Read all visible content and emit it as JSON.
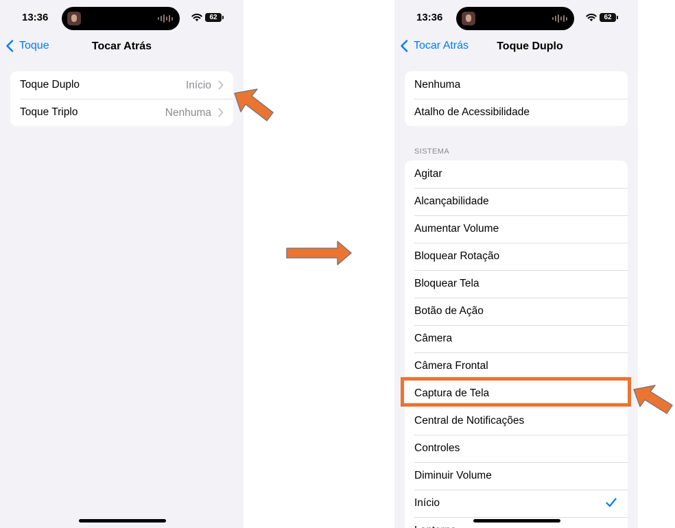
{
  "colors": {
    "accent": "#007aff",
    "annotation": "#ec7431",
    "background": "#f2f2f7"
  },
  "left_screen": {
    "status": {
      "time": "13:36",
      "battery": "62"
    },
    "nav": {
      "back_label": "Toque",
      "title": "Tocar Atrás"
    },
    "rows": [
      {
        "label": "Toque Duplo",
        "value": "Início"
      },
      {
        "label": "Toque Triplo",
        "value": "Nenhuma"
      }
    ]
  },
  "right_screen": {
    "status": {
      "time": "13:36",
      "battery": "62"
    },
    "nav": {
      "back_label": "Tocar Atrás",
      "title": "Toque Duplo"
    },
    "top_group": [
      "Nenhuma",
      "Atalho de Acessibilidade"
    ],
    "section_header": "SISTEMA",
    "system_items": [
      "Agitar",
      "Alcançabilidade",
      "Aumentar Volume",
      "Bloquear Rotação",
      "Bloquear Tela",
      "Botão de Ação",
      "Câmera",
      "Câmera Frontal",
      "Captura de Tela",
      "Central de Notificações",
      "Controles",
      "Diminuir Volume",
      "Início",
      "Lanterna"
    ],
    "selected_item": "Início",
    "highlighted_item": "Captura de Tela"
  },
  "icons": {
    "back": "chevron-left-icon",
    "disclosure": "chevron-right-icon",
    "selected": "checkmark-icon",
    "wifi": "wifi-icon",
    "battery": "battery-icon",
    "annotation": "arrow-icon"
  }
}
